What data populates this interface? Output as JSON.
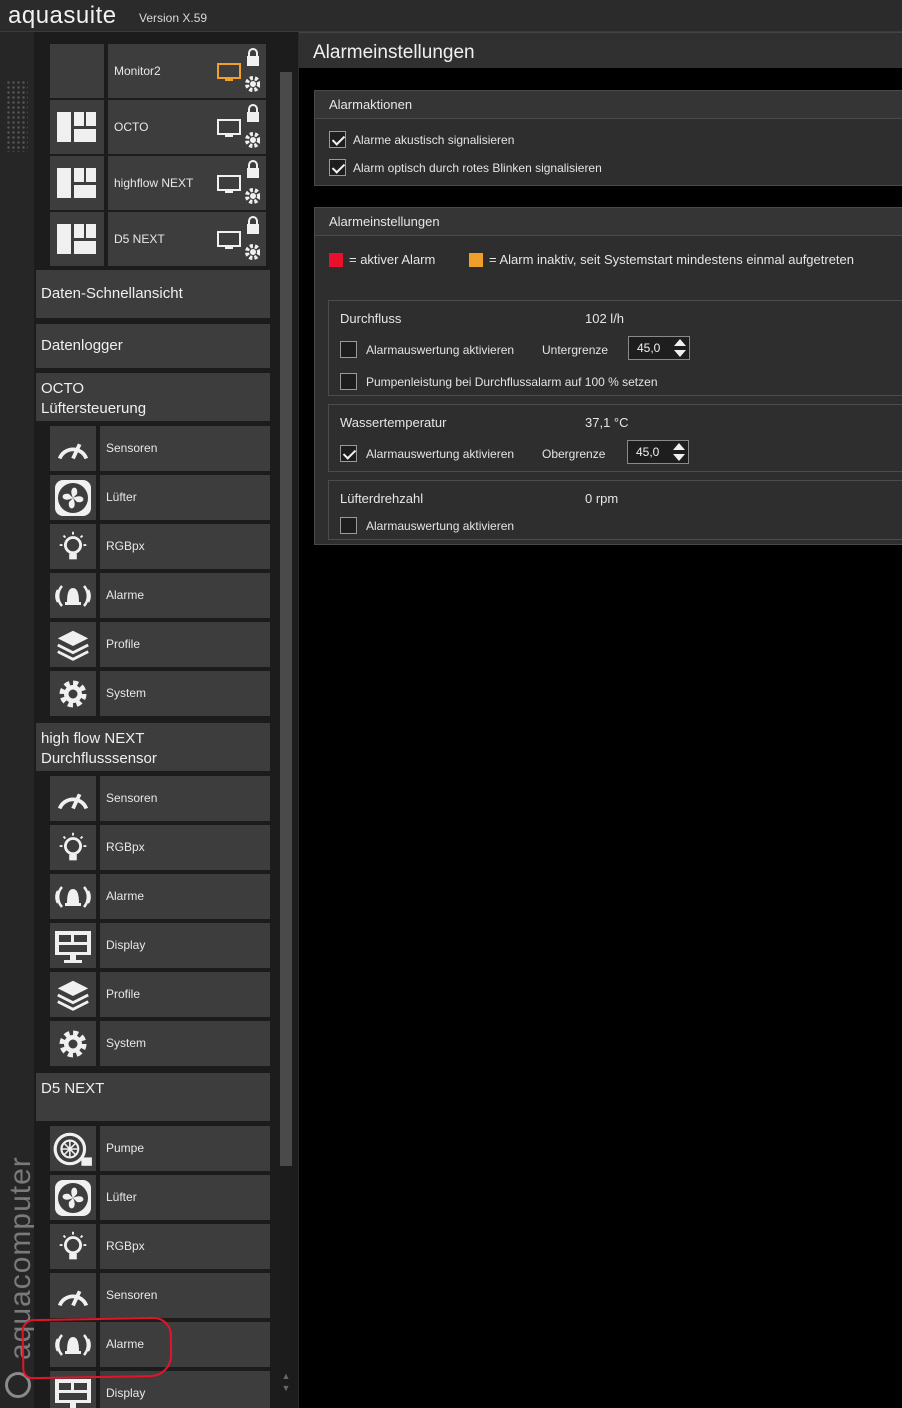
{
  "app": {
    "title": "aquasuite",
    "version": "Version X.59",
    "brand": "aquacomputer"
  },
  "colors": {
    "active_alarm": "#e8102a",
    "inactive_alarm": "#f0a02a",
    "monitor_active": "#f0a02a"
  },
  "sidebar": {
    "tiles": [
      {
        "label": "Monitor2"
      },
      {
        "label": "OCTO"
      },
      {
        "label": "highflow NEXT"
      },
      {
        "label": "D5 NEXT"
      }
    ],
    "quick_view": "Daten-Schnellansicht",
    "logger": "Datenlogger",
    "octo": {
      "title": "OCTO\nLüftersteuerung",
      "items": [
        "Sensoren",
        "Lüfter",
        "RGBpx",
        "Alarme",
        "Profile",
        "System"
      ]
    },
    "highflow": {
      "title": "high flow NEXT\nDurchflusssensor",
      "items": [
        "Sensoren",
        "RGBpx",
        "Alarme",
        "Display",
        "Profile",
        "System"
      ]
    },
    "d5": {
      "title": "D5 NEXT",
      "items": [
        "Pumpe",
        "Lüfter",
        "RGBpx",
        "Sensoren",
        "Alarme",
        "Display"
      ]
    }
  },
  "main": {
    "title": "Alarmeinstellungen",
    "actions": {
      "title": "Alarmaktionen",
      "acoustic": "Alarme akustisch signalisieren",
      "optical": "Alarm optisch durch rotes Blinken signalisieren"
    },
    "settings": {
      "title": "Alarmeinstellungen",
      "legend_active": "= aktiver Alarm",
      "legend_inactive": "= Alarm inaktiv, seit Systemstart mindestens einmal aufgetreten",
      "flow": {
        "title": "Durchfluss",
        "value": "102 l/h",
        "enable": "Alarmauswertung aktivieren",
        "limit_label": "Untergrenze",
        "limit": "45,0",
        "pump": "Pumpenleistung bei Durchflussalarm auf 100 % setzen"
      },
      "water": {
        "title": "Wassertemperatur",
        "value": "37,1 °C",
        "enable": "Alarmauswertung aktivieren",
        "limit_label": "Obergrenze",
        "limit": "45,0"
      },
      "fan": {
        "title": "Lüfterdrehzahl",
        "value": "0 rpm",
        "enable": "Alarmauswertung aktivieren"
      }
    }
  }
}
